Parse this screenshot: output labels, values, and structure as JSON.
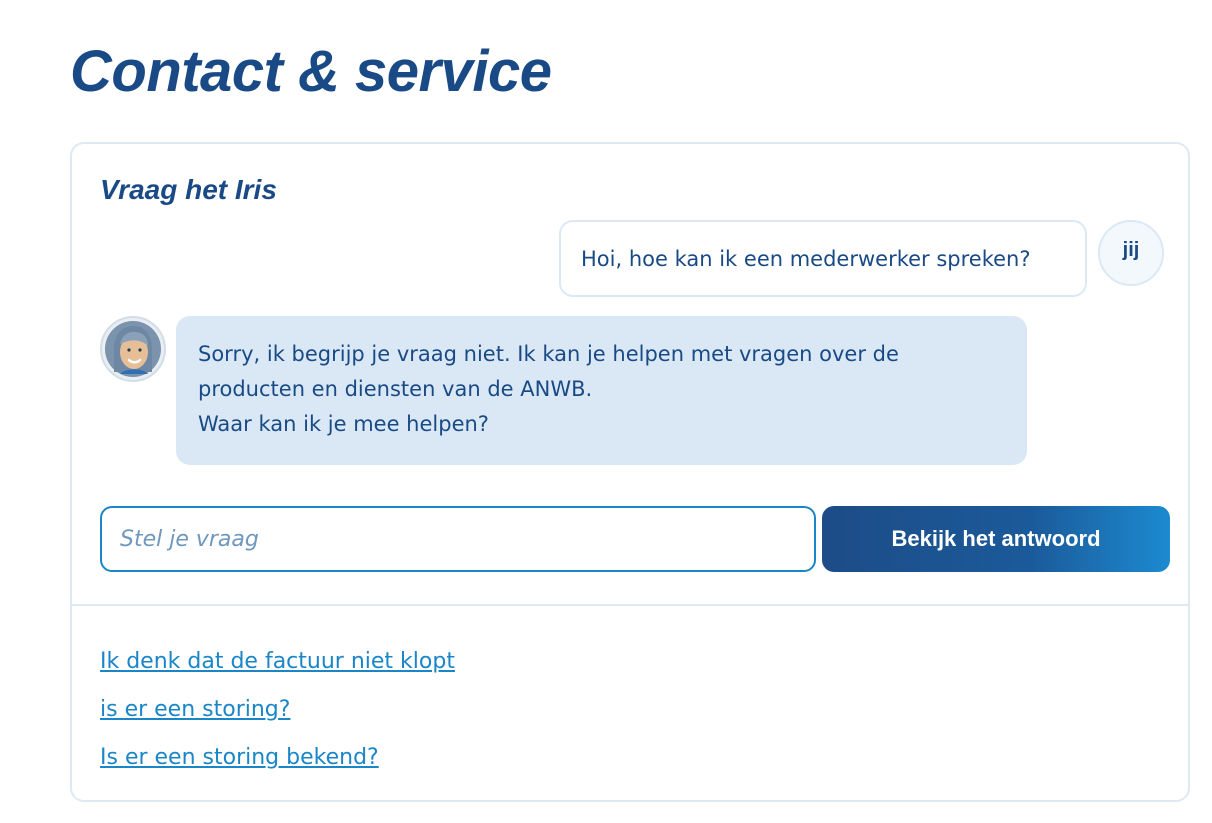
{
  "page": {
    "title": "Contact & service"
  },
  "chat": {
    "title": "Vraag het Iris",
    "user_message": "Hoi, hoe kan ik een mederwerker spreken?",
    "user_avatar_label": "jij",
    "bot_avatar_icon": "assistant-avatar-icon",
    "bot_message_lines": [
      "Sorry, ik begrijp je vraag niet.  Ik kan je helpen met vragen over de producten en diensten van de ANWB.",
      "Waar kan ik je mee helpen?"
    ],
    "input_placeholder": "Stel je vraag",
    "input_value": "",
    "submit_label": "Bekijk het antwoord"
  },
  "suggestions": [
    "Ik denk dat de factuur niet klopt",
    "is er een storing?",
    "Is er een storing bekend?"
  ],
  "colors": {
    "brand_blue": "#1a4a86",
    "link_blue": "#1a86c8",
    "bubble_bg": "#d9e8f4",
    "border": "#dde9f3"
  }
}
